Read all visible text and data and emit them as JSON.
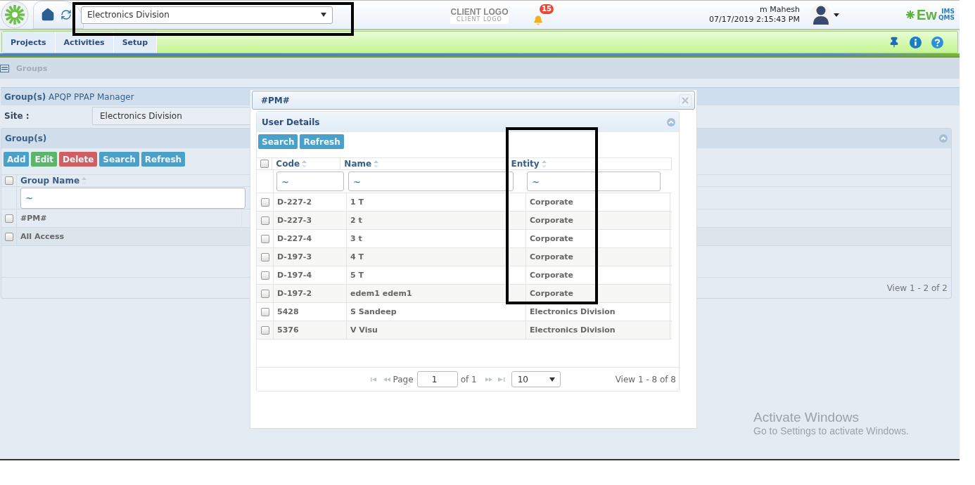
{
  "header": {
    "site_select": "Electronics Division",
    "client_logo": {
      "title": "CLIENT LOGO",
      "subtitle": "CLIENT LOGO"
    },
    "notification_count": "15",
    "user_name": "m Mahesh",
    "datetime": "07/17/2019 2:15:43 PM",
    "brand": {
      "main": "Ew",
      "top": "IMS",
      "bottom": "QMS"
    }
  },
  "nav_tabs": [
    {
      "label": "Projects"
    },
    {
      "label": "Activities"
    },
    {
      "label": "Setup"
    }
  ],
  "breadcrumb": [
    "Groups"
  ],
  "page_panel": {
    "title": "Group(s)",
    "subtitle": "APQP PPAP Manager"
  },
  "site": {
    "label": "Site :",
    "value": "Electronics Division"
  },
  "groups_panel": {
    "title": "Group(s)",
    "buttons": [
      {
        "label": "Add",
        "kind": "primary"
      },
      {
        "label": "Edit",
        "kind": "success"
      },
      {
        "label": "Delete",
        "kind": "danger"
      },
      {
        "label": "Search",
        "kind": "primary"
      },
      {
        "label": "Refresh",
        "kind": "primary"
      }
    ],
    "select_all_checked": false,
    "column": "Group Name",
    "filter": "~",
    "rows": [
      {
        "name": "#PM#",
        "checked": false
      },
      {
        "name": "All Access",
        "checked": false
      }
    ],
    "footer": "View 1 - 2 of 2"
  },
  "dialog": {
    "title": "#PM#",
    "panel_title": "User Details",
    "buttons": [
      {
        "label": "Search",
        "kind": "primary"
      },
      {
        "label": "Refresh",
        "kind": "primary"
      }
    ],
    "select_all_checked": false,
    "columns": [
      "Code",
      "Name",
      "Entity"
    ],
    "filters": [
      "~",
      "~",
      "~"
    ],
    "rows": [
      {
        "code": "D-227-2",
        "name": "1 T",
        "entity": "Corporate",
        "checked": false
      },
      {
        "code": "D-227-3",
        "name": "2 t",
        "entity": "Corporate",
        "checked": false
      },
      {
        "code": "D-227-4",
        "name": "3 t",
        "entity": "Corporate",
        "checked": false
      },
      {
        "code": "D-197-3",
        "name": "4 T",
        "entity": "Corporate",
        "checked": false
      },
      {
        "code": "D-197-4",
        "name": "5 T",
        "entity": "Corporate",
        "checked": false
      },
      {
        "code": "D-197-2",
        "name": "edem1 edem1",
        "entity": "Corporate",
        "checked": false
      },
      {
        "code": "5428",
        "name": "S Sandeep",
        "entity": "Electronics Division",
        "checked": false
      },
      {
        "code": "5376",
        "name": "V Visu",
        "entity": "Electronics Division",
        "checked": false
      }
    ],
    "pager": {
      "page_label": "Page",
      "page": "1",
      "of": "of 1",
      "page_size": "10",
      "view": "View 1 - 8 of 8"
    }
  },
  "system_notice": {
    "title": "Activate Windows",
    "text": "Go to Settings to activate Windows."
  }
}
